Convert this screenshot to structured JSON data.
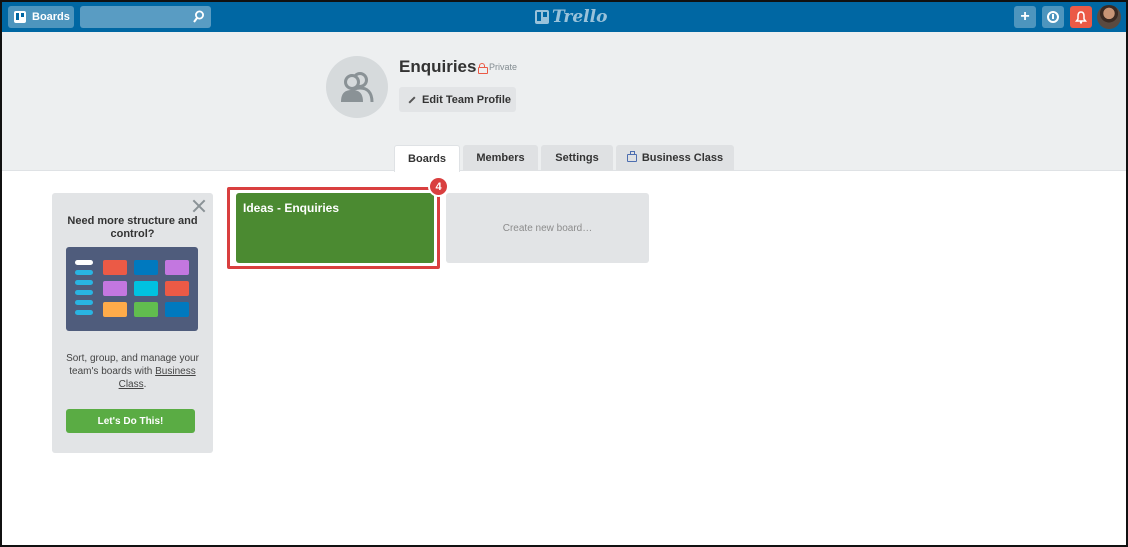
{
  "header": {
    "boards_label": "Boards",
    "search_value": "",
    "logo_text": "Trello",
    "add_symbol": "+"
  },
  "team": {
    "name": "Enquiries",
    "privacy": "Private",
    "edit_label": "Edit Team Profile"
  },
  "tabs": [
    {
      "label": "Boards",
      "active": true
    },
    {
      "label": "Members",
      "active": false
    },
    {
      "label": "Settings",
      "active": false
    },
    {
      "label": "Business Class",
      "active": false
    }
  ],
  "promo": {
    "title": "Need more structure and control?",
    "text_before": "Sort, group, and manage your team's boards with",
    "link_text": "Business Class",
    "text_after": ".",
    "button_label": "Let's Do This!"
  },
  "boards": [
    {
      "title": "Ideas - Enquiries",
      "color": "#4b8a31"
    }
  ],
  "create_board_label": "Create new board…",
  "annotation": {
    "step_number": "4"
  },
  "colors": {
    "header": "#0067a3",
    "highlight": "#d93f3f",
    "promo_button": "#5aac44",
    "notification": "#eb5a46"
  }
}
